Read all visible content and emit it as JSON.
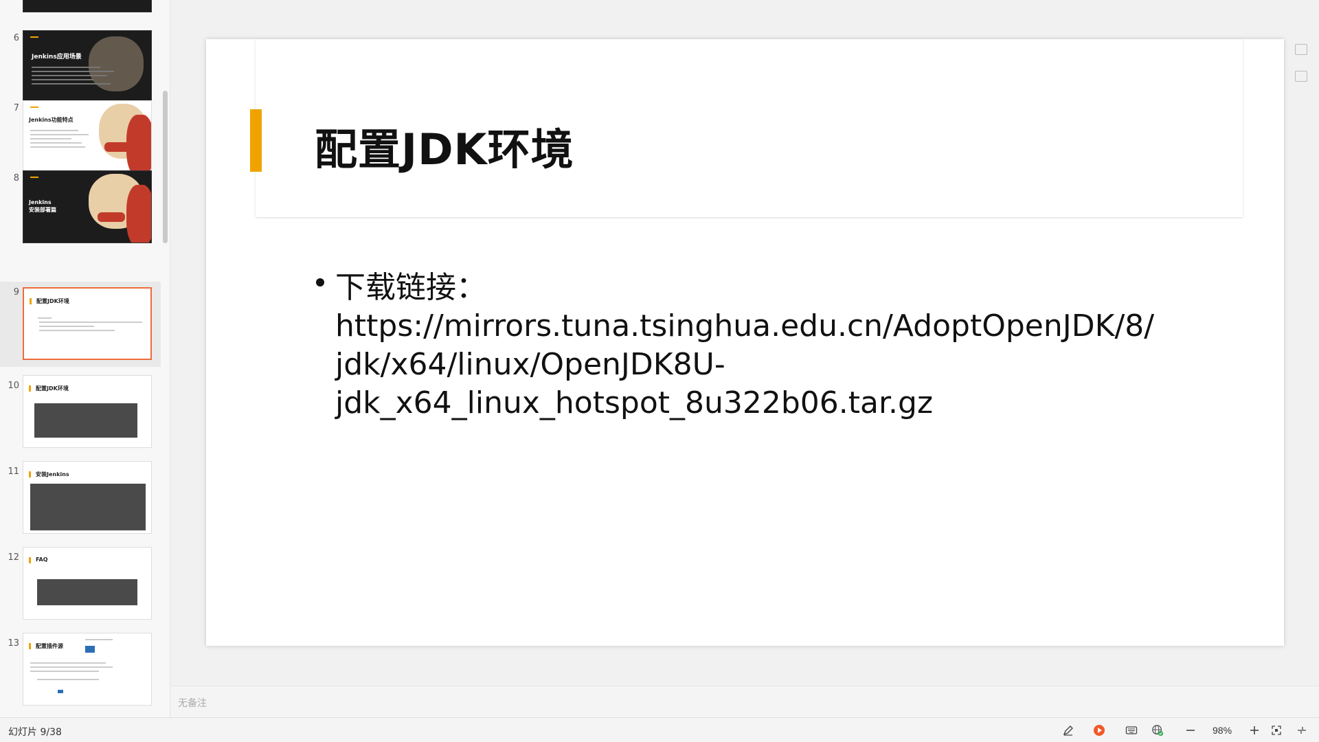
{
  "thumbnails": [
    {
      "num": "6",
      "title": "Jenkins应用场景",
      "dark": true
    },
    {
      "num": "7",
      "title": "Jenkins功能特点",
      "dark": false
    },
    {
      "num": "8",
      "title": "Jenkins\n安装部署篇",
      "dark": true
    },
    {
      "num": "9",
      "title": "配置JDK环境",
      "dark": false,
      "selected": true
    },
    {
      "num": "10",
      "title": "配置JDK环境",
      "dark": false
    },
    {
      "num": "11",
      "title": "安装Jenkins",
      "dark": false
    },
    {
      "num": "12",
      "title": "FAQ",
      "dark": false
    },
    {
      "num": "13",
      "title": "配置插件源",
      "dark": false
    }
  ],
  "slide": {
    "title": "配置JDK环境",
    "bullet_lines": [
      "下载链接：",
      "https://mirrors.tuna.tsinghua.edu.cn/AdoptOpenJDK/8/",
      "jdk/x64/linux/OpenJDK8U-",
      "jdk_x64_linux_hotspot_8u322b06.tar.gz"
    ]
  },
  "notes": {
    "placeholder": "无备注"
  },
  "status": {
    "slide_count": "幻灯片 9/38",
    "zoom": "98%"
  }
}
